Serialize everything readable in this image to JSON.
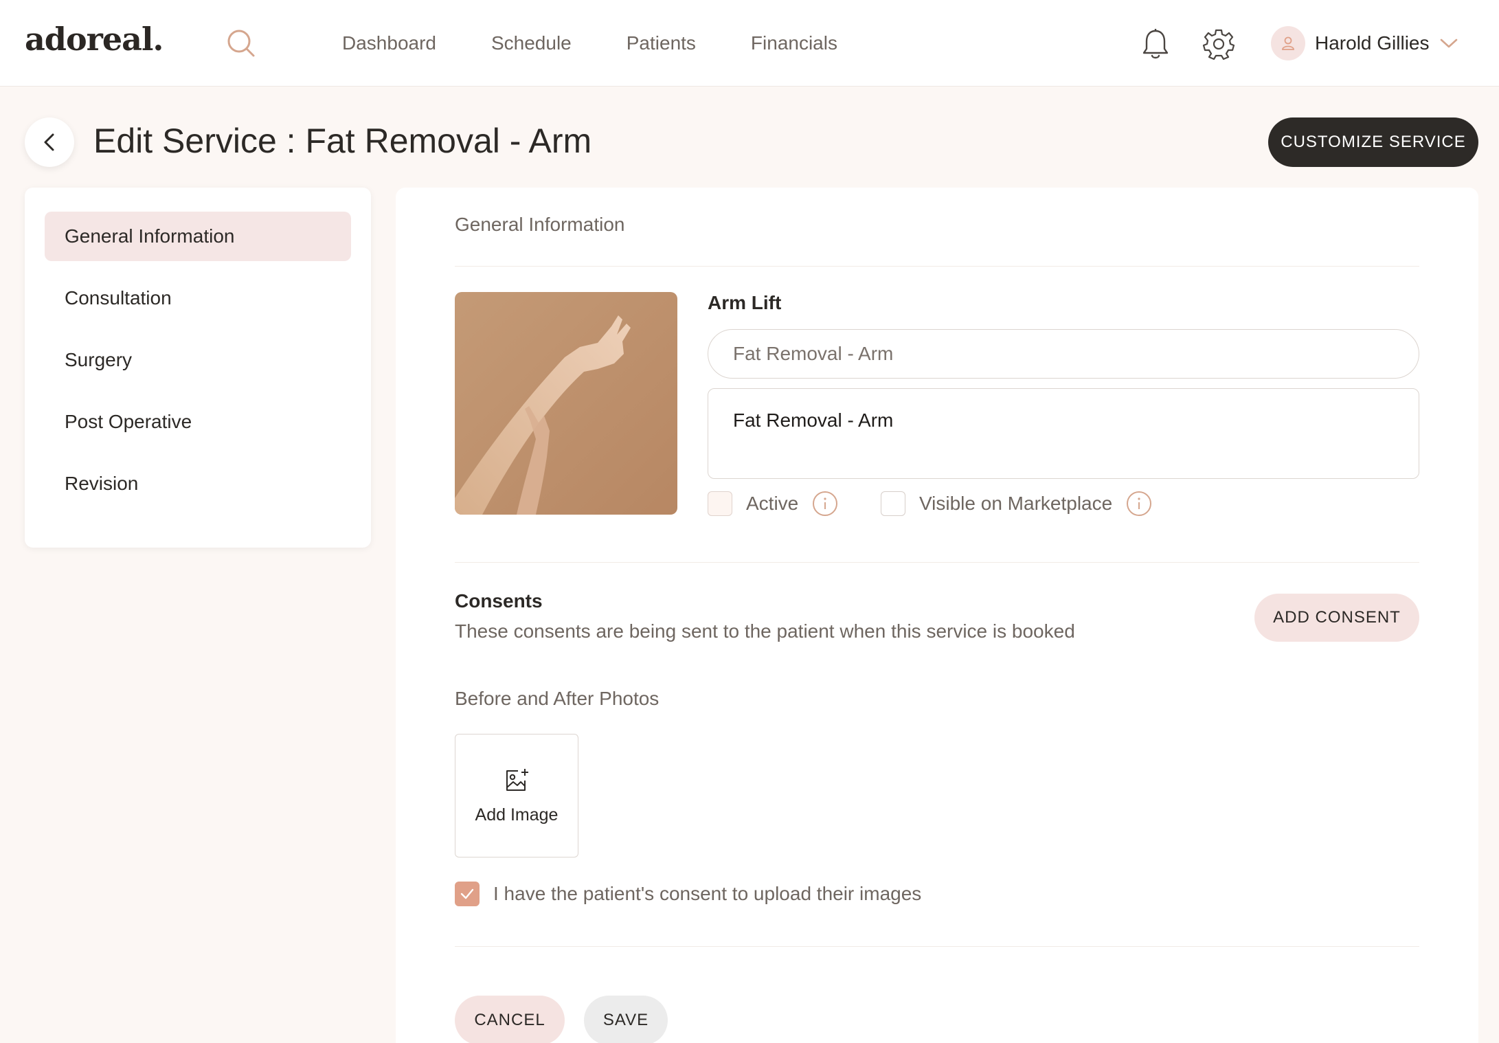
{
  "app": {
    "logo": "adoreal."
  },
  "nav": {
    "items": [
      {
        "label": "Dashboard"
      },
      {
        "label": "Schedule"
      },
      {
        "label": "Patients"
      },
      {
        "label": "Financials"
      }
    ]
  },
  "user": {
    "name": "Harold Gillies"
  },
  "header": {
    "title": "Edit Service : Fat Removal - Arm",
    "customize_label": "CUSTOMIZE SERVICE"
  },
  "sidebar": {
    "items": [
      {
        "label": "General Information",
        "active": true
      },
      {
        "label": "Consultation",
        "active": false
      },
      {
        "label": "Surgery",
        "active": false
      },
      {
        "label": "Post Operative",
        "active": false
      },
      {
        "label": "Revision",
        "active": false
      }
    ]
  },
  "general": {
    "section_title": "General Information",
    "field_label": "Arm Lift",
    "name_placeholder": "Fat Removal - Arm",
    "description_value": "Fat Removal - Arm",
    "active_label": "Active",
    "active_checked": false,
    "marketplace_label": "Visible on Marketplace",
    "marketplace_checked": false
  },
  "consents": {
    "title": "Consents",
    "description": "These consents are being sent to the patient when this service is booked",
    "add_label": "ADD CONSENT"
  },
  "photos": {
    "title": "Before and After Photos",
    "add_image_label": "Add Image",
    "consent_label": "I have the patient's consent to upload their images",
    "consent_checked": true
  },
  "actions": {
    "cancel_label": "CANCEL",
    "save_label": "SAVE"
  },
  "colors": {
    "accent": "#e0a088",
    "accent_soft": "#f5e3e1",
    "dark_button": "#2d2a27",
    "background": "#fcf7f4"
  }
}
